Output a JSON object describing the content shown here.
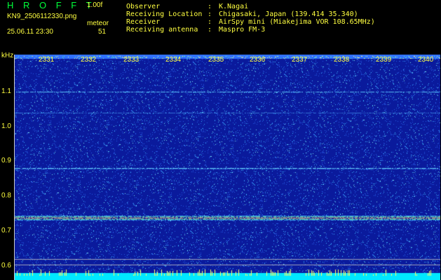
{
  "header": {
    "app_title": "H R O F F T",
    "version": "1.00f",
    "filename": "KN9_2506112330.png",
    "meteor_label": "meteor",
    "datetime": "25.06.11 23:30",
    "meteor_count": "51"
  },
  "info": {
    "observer_label": "Observer",
    "observer_value": "K.Nagai",
    "location_label": "Receiving Location",
    "location_value": "Chigasaki, Japan (139.414 35.340)",
    "receiver_label": "Receiver",
    "receiver_value": "AirSpy mini (Miakejima VOR 108.65MHz)",
    "antenna_label": "Receiving antenna",
    "antenna_value": "Maspro FM-3",
    "separator": ":"
  },
  "axis": {
    "y_unit": "kHz",
    "y_ticks": [
      "1.1",
      "1.0",
      "0.9",
      "0.8",
      "0.7",
      "0.6"
    ],
    "x_ticks": [
      "2331",
      "2332",
      "2333",
      "2334",
      "2335",
      "2336",
      "2337",
      "2338",
      "2339",
      "2340"
    ]
  },
  "colors": {
    "background": "#0a1a9c",
    "header_text": "#ffff40",
    "title_text": "#00ff3a",
    "bottom_strip": "#00e8ff"
  }
}
